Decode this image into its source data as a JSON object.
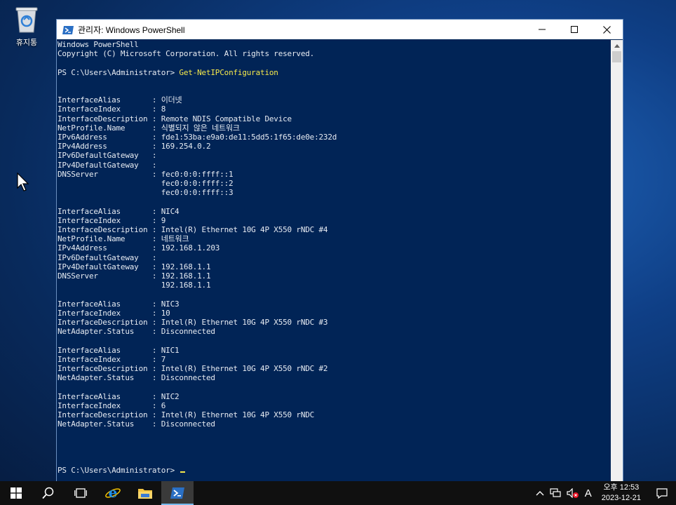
{
  "desktop": {
    "recycle_bin_label": "휴지통"
  },
  "window": {
    "title": "관리자: Windows PowerShell",
    "minimize": "—",
    "maximize": "☐",
    "close": "✕"
  },
  "console": {
    "lines": [
      "Windows PowerShell",
      "Copyright (C) Microsoft Corporation. All rights reserved.",
      "",
      "PS C:\\Users\\Administrator> ",
      "",
      "",
      "InterfaceAlias       : 이더넷",
      "InterfaceIndex       : 8",
      "InterfaceDescription : Remote NDIS Compatible Device",
      "NetProfile.Name      : 식별되지 않은 네트워크",
      "IPv6Address          : fde1:53ba:e9a0:de11:5dd5:1f65:de0e:232d",
      "IPv4Address          : 169.254.0.2",
      "IPv6DefaultGateway   :",
      "IPv4DefaultGateway   :",
      "DNSServer            : fec0:0:0:ffff::1",
      "                       fec0:0:0:ffff::2",
      "                       fec0:0:0:ffff::3",
      "",
      "InterfaceAlias       : NIC4",
      "InterfaceIndex       : 9",
      "InterfaceDescription : Intel(R) Ethernet 10G 4P X550 rNDC #4",
      "NetProfile.Name      : 네트워크",
      "IPv4Address          : 192.168.1.203",
      "IPv6DefaultGateway   :",
      "IPv4DefaultGateway   : 192.168.1.1",
      "DNSServer            : 192.168.1.1",
      "                       192.168.1.1",
      "",
      "InterfaceAlias       : NIC3",
      "InterfaceIndex       : 10",
      "InterfaceDescription : Intel(R) Ethernet 10G 4P X550 rNDC #3",
      "NetAdapter.Status    : Disconnected",
      "",
      "InterfaceAlias       : NIC1",
      "InterfaceIndex       : 7",
      "InterfaceDescription : Intel(R) Ethernet 10G 4P X550 rNDC #2",
      "NetAdapter.Status    : Disconnected",
      "",
      "InterfaceAlias       : NIC2",
      "InterfaceIndex       : 6",
      "InterfaceDescription : Intel(R) Ethernet 10G 4P X550 rNDC",
      "NetAdapter.Status    : Disconnected",
      "",
      "",
      "",
      "",
      "PS C:\\Users\\Administrator> "
    ],
    "command": "Get-NetIPConfiguration"
  },
  "taskbar": {
    "items": [
      "start-icon",
      "search-icon",
      "task-view-icon",
      "internet-explorer-icon",
      "file-explorer-icon",
      "powershell-icon"
    ],
    "ime_indicator": "A",
    "clock_time": "오후 12:53",
    "clock_date": "2023-12-21"
  },
  "colors": {
    "console_bg": "#012456",
    "console_text": "#e7ebf2",
    "command_text": "#f5e94b",
    "taskbar_bg": "#101010"
  }
}
